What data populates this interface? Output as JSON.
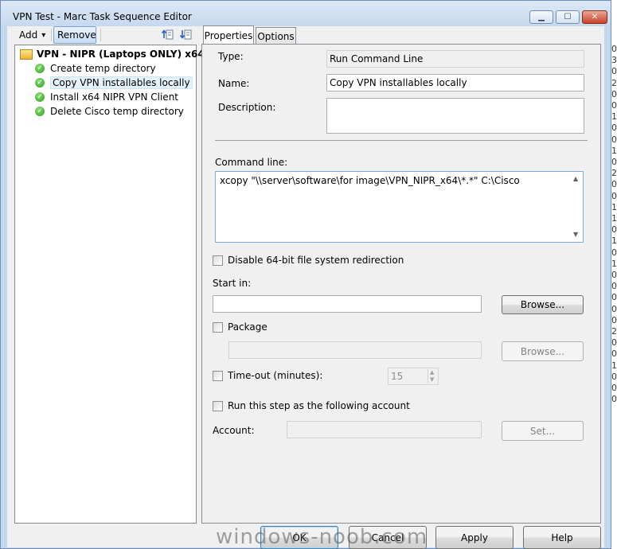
{
  "window": {
    "title": "VPN Test - Marc Task Sequence Editor",
    "controls": {
      "minimize": "▁",
      "maximize": "☐",
      "close": "✕"
    }
  },
  "background": {
    "right_edge_chars": [
      "0",
      "3",
      "0",
      "2",
      "0",
      "0",
      "1",
      "0",
      "0",
      "1",
      "0",
      "2",
      "0",
      "0",
      "1",
      "1",
      "0",
      "1",
      "0",
      "1",
      "0",
      "0",
      "0",
      "0",
      "0",
      "2",
      "0",
      "0",
      "1",
      "0",
      "0",
      "0"
    ]
  },
  "toolbar": {
    "add_label": "Add",
    "add_arrow": "▾",
    "remove_label": "Remove",
    "move_up_icon": "move-up-icon",
    "move_down_icon": "move-down-icon"
  },
  "tree": {
    "root_label": "VPN - NIPR (Laptops ONLY) x64",
    "items": [
      {
        "label": "Create temp directory",
        "selected": false
      },
      {
        "label": "Copy VPN installables locally",
        "selected": true
      },
      {
        "label": "Install x64 NIPR VPN Client",
        "selected": false
      },
      {
        "label": "Delete Cisco temp directory",
        "selected": false
      }
    ]
  },
  "tabs": [
    {
      "label": "Properties",
      "active": true
    },
    {
      "label": "Options",
      "active": false
    }
  ],
  "properties": {
    "type_label": "Type:",
    "type_value": "Run Command Line",
    "name_label": "Name:",
    "name_value": "Copy VPN installables locally",
    "description_label": "Description:",
    "description_value": "",
    "command_line_label": "Command line:",
    "command_line_value": "xcopy \"\\\\server\\software\\for image\\VPN_NIPR_x64\\*.*\" C:\\Cisco",
    "disable_redirection_label": "Disable 64-bit file system redirection",
    "disable_redirection_checked": false,
    "start_in_label": "Start in:",
    "start_in_value": "",
    "browse_label": "Browse...",
    "package_label": "Package",
    "package_checked": false,
    "package_value": "",
    "package_browse_label": "Browse...",
    "timeout_label": "Time-out (minutes):",
    "timeout_checked": false,
    "timeout_value": "15",
    "run_as_label": "Run this step as the following account",
    "run_as_checked": false,
    "account_label": "Account:",
    "account_value": "",
    "set_label": "Set..."
  },
  "footer": {
    "ok_label": "OK",
    "cancel_label": "Cancel",
    "apply_label": "Apply",
    "help_label": "Help"
  },
  "watermark": "windows-noob.com"
}
